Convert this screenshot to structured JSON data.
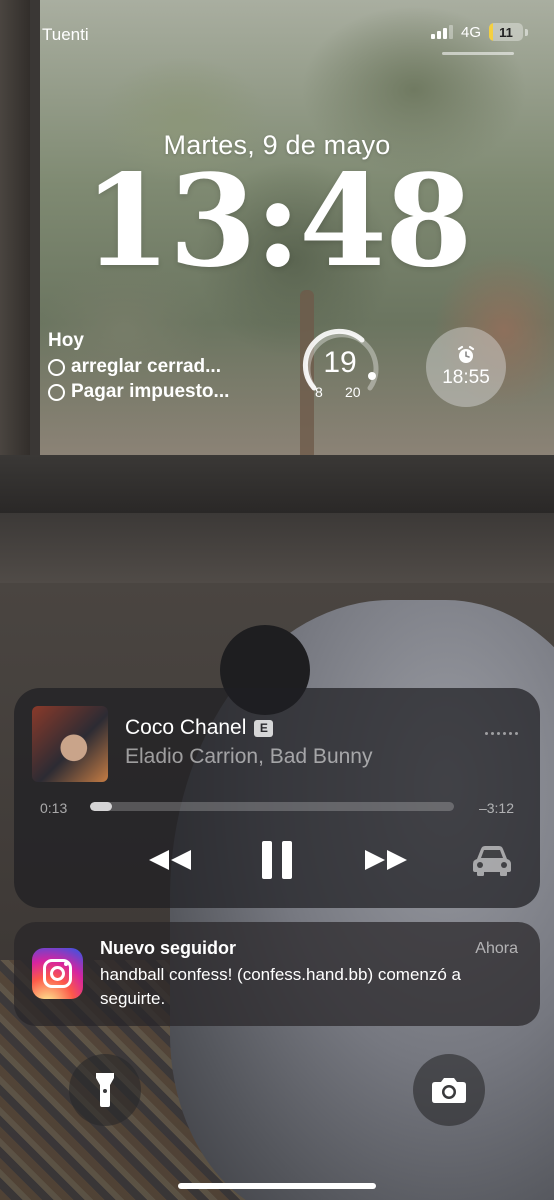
{
  "status_bar": {
    "carrier": "Tuenti",
    "network": "4G",
    "battery_level": "11",
    "battery_color": "#f4d03f",
    "battery_fraction": 0.11,
    "signal_bars": 3
  },
  "lock_screen": {
    "date": "Martes, 9 de mayo",
    "time": "13:48"
  },
  "widgets": {
    "reminders": {
      "title": "Hoy",
      "items": [
        {
          "label": "arreglar cerrad..."
        },
        {
          "label": "Pagar impuesto..."
        }
      ]
    },
    "temperature": {
      "current": "19",
      "low": "8",
      "high": "20",
      "icon": "temperature-gauge-icon"
    },
    "alarm": {
      "time": "18:55",
      "icon": "alarm-clock-icon"
    }
  },
  "now_playing": {
    "title": "Coco Chanel",
    "explicit_badge": "E",
    "artist": "Eladio Carrion, Bad Bunny",
    "elapsed": "0:13",
    "remaining": "–3:12",
    "progress_fraction": 0.06,
    "controls": [
      {
        "name": "rewind",
        "icon": "rewind-icon"
      },
      {
        "name": "pause",
        "icon": "pause-icon"
      },
      {
        "name": "fast-forward",
        "icon": "fast-forward-icon"
      },
      {
        "name": "car-audio",
        "icon": "car-icon"
      }
    ]
  },
  "notification": {
    "app": "Instagram",
    "icon": "instagram-icon",
    "title": "Nuevo seguidor",
    "time": "Ahora",
    "body": "handball confess! (confess.hand.bb) comenzó a seguirte."
  },
  "quick_actions": {
    "flashlight_icon": "flashlight-icon",
    "camera_icon": "camera-icon"
  }
}
